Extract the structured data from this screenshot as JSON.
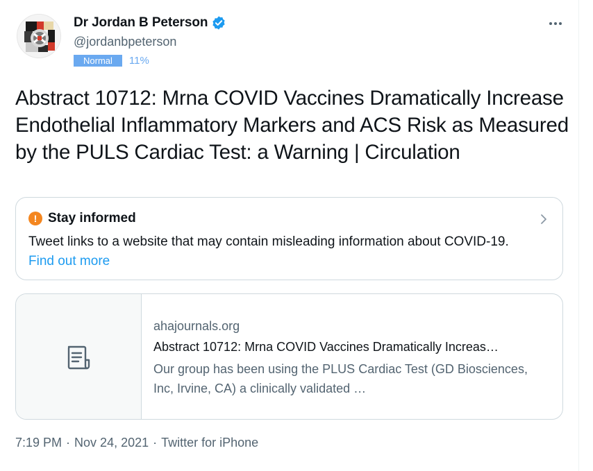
{
  "author": {
    "display_name": "Dr Jordan B Peterson",
    "handle": "@jordanbpeterson",
    "verified": true
  },
  "label": {
    "badge": "Normal",
    "percent": "11%"
  },
  "tweet": {
    "text": "Abstract 10712: Mrna COVID Vaccines Dramatically Increase Endothelial Inflammatory Markers and ACS Risk as Measured by the PULS Cardiac Test: a Warning | Circulation"
  },
  "notice": {
    "title": "Stay informed",
    "body": "Tweet links to a website that may contain misleading information about COVID-19.",
    "link": "Find out more"
  },
  "link_card": {
    "domain": "ahajournals.org",
    "title": "Abstract 10712: Mrna COVID Vaccines Dramatically Increas…",
    "description": "Our group has been using the PLUS Cardiac Test (GD Biosciences, Inc, Irvine, CA) a clinically validated …"
  },
  "meta": {
    "time": "7:19 PM",
    "separator": "·",
    "date": "Nov 24, 2021",
    "source": "Twitter for iPhone"
  },
  "colors": {
    "accent": "#1d9bf0",
    "warning": "#f4861f",
    "badge": "#6aa9f0"
  },
  "icons": {
    "verified": "verified-badge-icon",
    "more": "more-horizontal-icon",
    "warning": "exclamation-circle-icon",
    "chevron": "chevron-right-icon",
    "document": "document-icon"
  }
}
